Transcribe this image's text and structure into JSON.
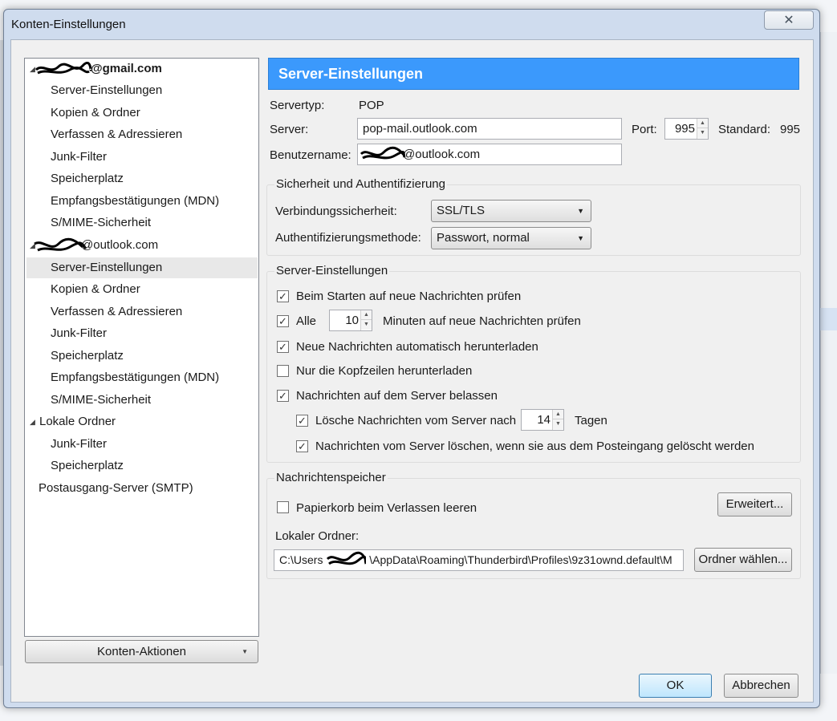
{
  "window": {
    "title": "Konten-Einstellungen",
    "close_glyph": "✕"
  },
  "tree": {
    "items": [
      {
        "label": "@gmail.com",
        "bold": true
      },
      {
        "label": "Server-Einstellungen"
      },
      {
        "label": "Kopien & Ordner"
      },
      {
        "label": "Verfassen & Adressieren"
      },
      {
        "label": "Junk-Filter"
      },
      {
        "label": "Speicherplatz"
      },
      {
        "label": "Empfangsbestätigungen (MDN)"
      },
      {
        "label": "S/MIME-Sicherheit"
      },
      {
        "label": "@outlook.com"
      },
      {
        "label": "Server-Einstellungen",
        "selected": true
      },
      {
        "label": "Kopien & Ordner"
      },
      {
        "label": "Verfassen & Adressieren"
      },
      {
        "label": "Junk-Filter"
      },
      {
        "label": "Speicherplatz"
      },
      {
        "label": "Empfangsbestätigungen (MDN)"
      },
      {
        "label": "S/MIME-Sicherheit"
      },
      {
        "label": "Lokale Ordner"
      },
      {
        "label": "Junk-Filter"
      },
      {
        "label": "Speicherplatz"
      },
      {
        "label": "Postausgang-Server (SMTP)"
      }
    ],
    "actions_button": "Konten-Aktionen"
  },
  "header": {
    "title": "Server-Einstellungen"
  },
  "server": {
    "type_label": "Servertyp:",
    "type_value": "POP",
    "server_label": "Server:",
    "server_value": "pop-mail.outlook.com",
    "port_label": "Port:",
    "port_value": "995",
    "standard_label": "Standard:",
    "standard_value": "995",
    "username_label": "Benutzername:",
    "username_value": "@outlook.com"
  },
  "security": {
    "group_title": "Sicherheit und Authentifizierung",
    "conn_label": "Verbindungssicherheit:",
    "conn_value": "SSL/TLS",
    "auth_label": "Authentifizierungsmethode:",
    "auth_value": "Passwort, normal"
  },
  "settings": {
    "group_title": "Server-Einstellungen",
    "check_startup": "Beim Starten auf neue Nachrichten prüfen",
    "every_prefix": "Alle",
    "every_value": "10",
    "every_suffix": "Minuten auf neue Nachrichten prüfen",
    "auto_download": "Neue Nachrichten automatisch herunterladen",
    "headers_only": "Nur die Kopfzeilen herunterladen",
    "leave_on_server": "Nachrichten auf dem Server belassen",
    "delete_after_prefix": "Lösche Nachrichten vom Server nach",
    "delete_after_value": "14",
    "delete_after_suffix": "Tagen",
    "delete_when_removed": "Nachrichten vom Server löschen, wenn sie aus dem Posteingang gelöscht werden"
  },
  "storage": {
    "group_title": "Nachrichtenspeicher",
    "empty_trash": "Papierkorb beim Verlassen leeren",
    "advanced_button": "Erweitert...",
    "local_folder_label": "Lokaler Ordner:",
    "path_prefix": "C:\\Users",
    "path_suffix": "\\AppData\\Roaming\\Thunderbird\\Profiles\\9z31ownd.default\\M",
    "choose_folder_button": "Ordner wählen..."
  },
  "footer": {
    "ok": "OK",
    "cancel": "Abbrechen"
  },
  "checkbox_states": {
    "check_startup": true,
    "every": true,
    "auto_download": true,
    "headers_only": false,
    "leave_on_server": true,
    "delete_after": true,
    "delete_when_removed": true,
    "empty_trash": false
  },
  "colors": {
    "header_bg": "#3b99fc",
    "selection_bg": "#e8e8e8",
    "dialog_frame": "#cfdcee"
  }
}
